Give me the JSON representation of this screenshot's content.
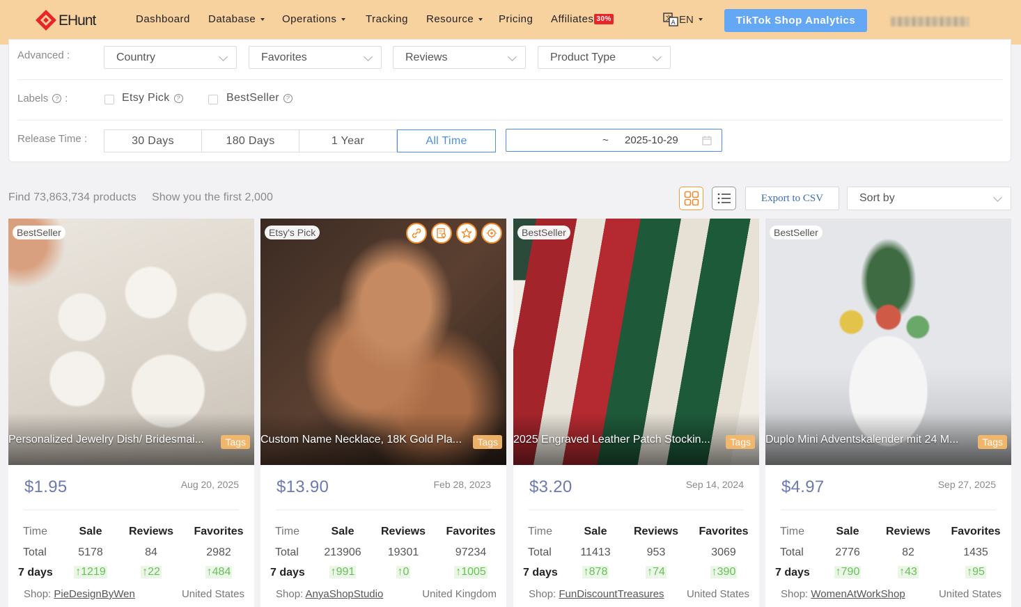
{
  "brand": {
    "name": "EHunt"
  },
  "nav": {
    "items": [
      "Dashboard",
      "Database",
      "Operations",
      "Tracking",
      "Resource",
      "Pricing",
      "Affiliates"
    ],
    "affiliate_badge": "30%",
    "lang": "EN",
    "tiktok_button": "TikTok Shop Analytics"
  },
  "filters": {
    "advanced_label": "Advanced :",
    "selects": [
      "Country",
      "Favorites",
      "Reviews",
      "Product Type"
    ],
    "labels_label": "Labels",
    "label_options": [
      "Etsy Pick",
      "BestSeller"
    ],
    "release_label": "Release Time :",
    "release_options": [
      "30 Days",
      "180 Days",
      "1 Year",
      "All Time"
    ],
    "release_active": "All Time",
    "date_sep": "~",
    "date_end": "2025-10-29"
  },
  "results": {
    "found": "Find 73,863,734 products",
    "showing": "Show you the first 2,000",
    "export": "Export to CSV",
    "sort": "Sort by"
  },
  "card_labels": {
    "time": "Time",
    "sale": "Sale",
    "reviews": "Reviews",
    "favorites": "Favorites",
    "total": "Total",
    "week": "7 days",
    "shop": "Shop:",
    "tags": "Tags"
  },
  "products": [
    {
      "badge": "BestSeller",
      "title": "Personalized Jewelry Dish/ Bridesmai...",
      "price": "$1.95",
      "date": "Aug 20, 2025",
      "total": {
        "sale": "5178",
        "reviews": "84",
        "favorites": "2982"
      },
      "week": {
        "sale": "↑1219",
        "reviews": "↑22",
        "favorites": "↑484"
      },
      "shop": "PieDesignByWen",
      "country": "United States"
    },
    {
      "badge": "Etsy's Pick",
      "title": "Custom Name Necklace, 18K Gold Pla...",
      "price": "$13.90",
      "date": "Feb 28, 2023",
      "total": {
        "sale": "213906",
        "reviews": "19301",
        "favorites": "97234"
      },
      "week": {
        "sale": "↑991",
        "reviews": "↑0",
        "favorites": "↑1005"
      },
      "shop": "AnyaShopStudio",
      "country": "United Kingdom"
    },
    {
      "badge": "BestSeller",
      "title": "2025 Engraved Leather Patch Stockin...",
      "price": "$3.20",
      "date": "Sep 14, 2024",
      "total": {
        "sale": "11413",
        "reviews": "953",
        "favorites": "3069"
      },
      "week": {
        "sale": "↑878",
        "reviews": "↑74",
        "favorites": "↑390"
      },
      "shop": "FunDiscountTreasures",
      "country": "United States"
    },
    {
      "badge": "BestSeller",
      "title": "Duplo Mini Adventskalender mit 24 M...",
      "price": "$4.97",
      "date": "Sep 27, 2025",
      "total": {
        "sale": "2776",
        "reviews": "82",
        "favorites": "1435"
      },
      "week": {
        "sale": "↑790",
        "reviews": "↑43",
        "favorites": "↑95"
      },
      "shop": "WomenAtWorkShop",
      "country": "United States"
    }
  ],
  "colors": {
    "nav_bg": "#f7d29e",
    "accent_blue": "#4b8ee6",
    "accent_orange": "#f08a2a",
    "up_green": "#6bbf5a"
  }
}
